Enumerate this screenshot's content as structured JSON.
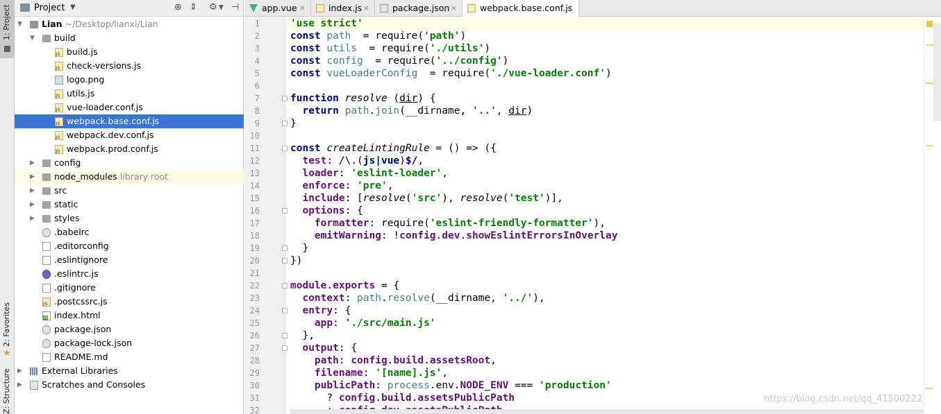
{
  "tool_strip": {
    "project_label": "1: Project",
    "favorites_label": "2: Favorites",
    "structure_label": "Z: Structure"
  },
  "project_panel": {
    "title": "Project",
    "tree": [
      {
        "indent": 0,
        "arrow": "open",
        "icon": "folder root",
        "name": "Lian",
        "sub": "~/Desktop/lianxi/Lian",
        "bold": true
      },
      {
        "indent": 1,
        "arrow": "open",
        "icon": "folder",
        "name": "build"
      },
      {
        "indent": 2,
        "icon": "js",
        "name": "build.js"
      },
      {
        "indent": 2,
        "icon": "js",
        "name": "check-versions.js"
      },
      {
        "indent": 2,
        "icon": "img",
        "name": "logo.png"
      },
      {
        "indent": 2,
        "icon": "js",
        "name": "utils.js"
      },
      {
        "indent": 2,
        "icon": "js",
        "name": "vue-loader.conf.js"
      },
      {
        "indent": 2,
        "icon": "js",
        "name": "webpack.base.conf.js",
        "selected": true
      },
      {
        "indent": 2,
        "icon": "js",
        "name": "webpack.dev.conf.js"
      },
      {
        "indent": 2,
        "icon": "js",
        "name": "webpack.prod.conf.js"
      },
      {
        "indent": 1,
        "arrow": "closed",
        "icon": "folder",
        "name": "config"
      },
      {
        "indent": 1,
        "arrow": "closed",
        "icon": "folder",
        "name": "node_modules",
        "sub": "library root",
        "hl": true
      },
      {
        "indent": 1,
        "arrow": "closed",
        "icon": "folder",
        "name": "src"
      },
      {
        "indent": 1,
        "arrow": "closed",
        "icon": "folder",
        "name": "static"
      },
      {
        "indent": 1,
        "arrow": "closed",
        "icon": "folder",
        "name": "styles"
      },
      {
        "indent": 1,
        "icon": "gear",
        "name": ".babelrc"
      },
      {
        "indent": 1,
        "icon": "txt",
        "name": ".editorconfig"
      },
      {
        "indent": 1,
        "icon": "txt",
        "name": ".eslintignore"
      },
      {
        "indent": 1,
        "icon": "eslint",
        "name": ".eslintrc.js"
      },
      {
        "indent": 1,
        "icon": "txt",
        "name": ".gitignore"
      },
      {
        "indent": 1,
        "icon": "js",
        "name": ".postcssrc.js"
      },
      {
        "indent": 1,
        "icon": "html",
        "name": "index.html"
      },
      {
        "indent": 1,
        "icon": "gear",
        "name": "package.json"
      },
      {
        "indent": 1,
        "icon": "gear",
        "name": "package-lock.json"
      },
      {
        "indent": 1,
        "icon": "txt",
        "name": "README.md"
      },
      {
        "indent": 0,
        "arrow": "closed",
        "icon": "lib",
        "name": "External Libraries"
      },
      {
        "indent": 0,
        "arrow": "closed",
        "icon": "scratch",
        "name": "Scratches and Consoles"
      }
    ]
  },
  "editor_tabs": [
    {
      "label": "app.vue",
      "icon": "vue"
    },
    {
      "label": "index.js",
      "icon": "js"
    },
    {
      "label": "package.json",
      "icon": "json"
    },
    {
      "label": "webpack.base.conf.js",
      "icon": "js",
      "active": true
    }
  ],
  "line_numbers": [
    "1",
    "2",
    "3",
    "4",
    "5",
    "6",
    "7",
    "8",
    "9",
    "10",
    "11",
    "12",
    "13",
    "14",
    "15",
    "16",
    "17",
    "18",
    "19",
    "20",
    "21",
    "22",
    "23",
    "24",
    "25",
    "26",
    "27",
    "28",
    "29",
    "30",
    "31",
    "32"
  ],
  "code_lines": [
    [
      [
        "str",
        "'use strict'"
      ]
    ],
    [
      [
        "kw",
        "const "
      ],
      [
        "gl",
        "path"
      ],
      [
        "",
        "  = require("
      ],
      [
        "str",
        "'path'"
      ],
      [
        "",
        ")"
      ]
    ],
    [
      [
        "kw",
        "const "
      ],
      [
        "gl",
        "utils"
      ],
      [
        "",
        "  = require("
      ],
      [
        "str",
        "'./utils'"
      ],
      [
        "",
        ")"
      ]
    ],
    [
      [
        "kw",
        "const "
      ],
      [
        "gl",
        "config"
      ],
      [
        "",
        "  = require("
      ],
      [
        "str",
        "'../config'"
      ],
      [
        "",
        ")"
      ]
    ],
    [
      [
        "kw",
        "const "
      ],
      [
        "gl",
        "vueLoaderConfig"
      ],
      [
        "",
        "  = require("
      ],
      [
        "str",
        "'./vue-loader.conf'"
      ],
      [
        "",
        ")"
      ]
    ],
    [],
    [
      [
        "kw",
        "function "
      ],
      [
        "it",
        "resolve"
      ],
      [
        "",
        " ("
      ],
      [
        "ul",
        "dir"
      ],
      [
        "",
        ") {"
      ]
    ],
    [
      [
        "",
        "  "
      ],
      [
        "kw",
        "return "
      ],
      [
        "gl",
        "path"
      ],
      [
        "",
        "."
      ],
      [
        "gl",
        "join"
      ],
      [
        "",
        "(__dirname, "
      ],
      [
        "str",
        "'..'"
      ],
      [
        "",
        ", "
      ],
      [
        "ul",
        "dir"
      ],
      [
        "",
        ")"
      ]
    ],
    [
      [
        "",
        "}"
      ]
    ],
    [],
    [
      [
        "kw",
        "const "
      ],
      [
        "it",
        "createLintingRule"
      ],
      [
        "",
        " = () => ({"
      ]
    ],
    [
      [
        "",
        "  "
      ],
      [
        "fld",
        "test"
      ],
      [
        "",
        ": /\\.("
      ],
      [
        "rx",
        "js|vue"
      ],
      [
        "",
        ")"
      ],
      [
        "kw",
        "$/"
      ],
      [
        "",
        ","
      ]
    ],
    [
      [
        "",
        "  "
      ],
      [
        "fld",
        "loader"
      ],
      [
        "",
        ": "
      ],
      [
        "str",
        "'eslint-loader'"
      ],
      [
        "",
        ","
      ]
    ],
    [
      [
        "",
        "  "
      ],
      [
        "fld",
        "enforce"
      ],
      [
        "",
        ": "
      ],
      [
        "str",
        "'pre'"
      ],
      [
        "",
        ","
      ]
    ],
    [
      [
        "",
        "  "
      ],
      [
        "fld",
        "include"
      ],
      [
        "",
        ": ["
      ],
      [
        "it",
        "resolve"
      ],
      [
        "",
        "("
      ],
      [
        "str",
        "'src'"
      ],
      [
        "",
        "), "
      ],
      [
        "it",
        "resolve"
      ],
      [
        "",
        "("
      ],
      [
        "str",
        "'test'"
      ],
      [
        "",
        ")],"
      ]
    ],
    [
      [
        "",
        "  "
      ],
      [
        "fld",
        "options"
      ],
      [
        "",
        ": {"
      ]
    ],
    [
      [
        "",
        "    "
      ],
      [
        "fld",
        "formatter"
      ],
      [
        "",
        ": require("
      ],
      [
        "str",
        "'eslint-friendly-formatter'"
      ],
      [
        "",
        "),"
      ]
    ],
    [
      [
        "",
        "    "
      ],
      [
        "fld",
        "emitWarning"
      ],
      [
        "",
        ": !"
      ],
      [
        "fld",
        "config"
      ],
      [
        "",
        "."
      ],
      [
        "fld",
        "dev"
      ],
      [
        "",
        "."
      ],
      [
        "fld",
        "showEslintErrorsInOverlay"
      ]
    ],
    [
      [
        "",
        "  }"
      ]
    ],
    [
      [
        "",
        "})"
      ]
    ],
    [],
    [
      [
        "fld",
        "module"
      ],
      [
        "",
        "."
      ],
      [
        "fld",
        "exports"
      ],
      [
        "",
        " = {"
      ]
    ],
    [
      [
        "",
        "  "
      ],
      [
        "fld",
        "context"
      ],
      [
        "",
        ": "
      ],
      [
        "gl",
        "path"
      ],
      [
        "",
        "."
      ],
      [
        "gl",
        "resolve"
      ],
      [
        "",
        "(__dirname, "
      ],
      [
        "str",
        "'../'"
      ],
      [
        "",
        "),"
      ]
    ],
    [
      [
        "",
        "  "
      ],
      [
        "fld",
        "entry"
      ],
      [
        "",
        ": {"
      ]
    ],
    [
      [
        "",
        "    "
      ],
      [
        "fld",
        "app"
      ],
      [
        "",
        ": "
      ],
      [
        "str",
        "'./src/main.js'"
      ]
    ],
    [
      [
        "",
        "  },"
      ]
    ],
    [
      [
        "",
        "  "
      ],
      [
        "fld",
        "output"
      ],
      [
        "",
        ": {"
      ]
    ],
    [
      [
        "",
        "    "
      ],
      [
        "fld",
        "path"
      ],
      [
        "",
        ": "
      ],
      [
        "fld",
        "config"
      ],
      [
        "",
        "."
      ],
      [
        "fld",
        "build"
      ],
      [
        "",
        "."
      ],
      [
        "fld",
        "assetsRoot"
      ],
      [
        "",
        ","
      ]
    ],
    [
      [
        "",
        "    "
      ],
      [
        "fld",
        "filename"
      ],
      [
        "",
        ": "
      ],
      [
        "str",
        "'[name].js'"
      ],
      [
        "",
        ","
      ]
    ],
    [
      [
        "",
        "    "
      ],
      [
        "fld",
        "publicPath"
      ],
      [
        "",
        ": "
      ],
      [
        "gl",
        "process"
      ],
      [
        "",
        ".env."
      ],
      [
        "fld",
        "NODE_ENV"
      ],
      [
        "",
        " === "
      ],
      [
        "str",
        "'production'"
      ]
    ],
    [
      [
        "",
        "      ? "
      ],
      [
        "fld",
        "config"
      ],
      [
        "",
        "."
      ],
      [
        "fld",
        "build"
      ],
      [
        "",
        "."
      ],
      [
        "fld",
        "assetsPublicPath"
      ]
    ],
    [
      [
        "",
        "      : "
      ],
      [
        "fld",
        "config"
      ],
      [
        "",
        "."
      ],
      [
        "fld",
        "dev"
      ],
      [
        "",
        "."
      ],
      [
        "fld",
        "assetsPublicPath"
      ]
    ]
  ],
  "watermark": "https://blog.csdn.net/qq_41500222"
}
